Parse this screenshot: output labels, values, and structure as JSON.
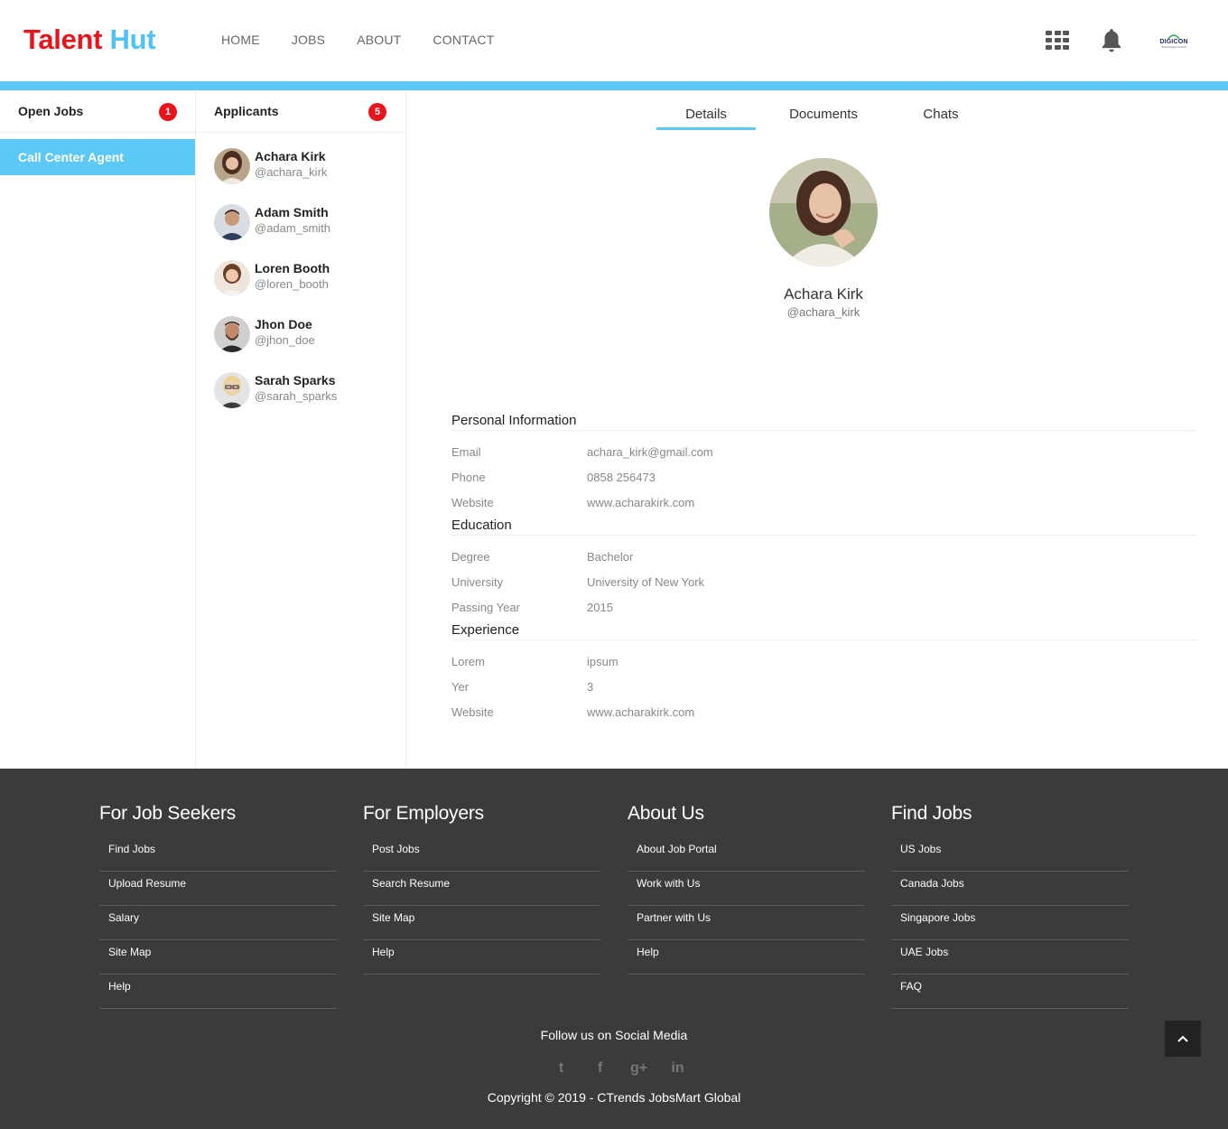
{
  "brand": {
    "part1": "Talent",
    "part2": "Hut"
  },
  "nav": [
    "HOME",
    "JOBS",
    "ABOUT",
    "CONTACT"
  ],
  "header_icons": {
    "apps": "grid-icon",
    "notifications": "bell-icon",
    "company_logo_text": "DIGICON",
    "company_logo_sub": "Technologies Limited"
  },
  "open_jobs": {
    "title": "Open Jobs",
    "count": "1",
    "items": [
      "Call Center Agent"
    ]
  },
  "applicants": {
    "title": "Applicants",
    "count": "5",
    "items": [
      {
        "name": "Achara Kirk",
        "handle": "@achara_kirk"
      },
      {
        "name": "Adam Smith",
        "handle": "@adam_smith"
      },
      {
        "name": "Loren Booth",
        "handle": "@loren_booth"
      },
      {
        "name": "Jhon Doe",
        "handle": "@jhon_doe"
      },
      {
        "name": "Sarah Sparks",
        "handle": "@sarah_sparks"
      }
    ]
  },
  "tabs": [
    "Details",
    "Documents",
    "Chats"
  ],
  "profile": {
    "name": "Achara Kirk",
    "handle": "@achara_kirk"
  },
  "personal": {
    "title": "Personal Information",
    "rows": [
      {
        "label": "Email",
        "value": "achara_kirk@gmail.com"
      },
      {
        "label": "Phone",
        "value": "0858 256473"
      },
      {
        "label": "Website",
        "value": "www.acharakirk.com"
      }
    ]
  },
  "education": {
    "title": "Education",
    "rows": [
      {
        "label": "Degree",
        "value": "Bachelor"
      },
      {
        "label": "University",
        "value": "University of New York"
      },
      {
        "label": "Passing Year",
        "value": "2015"
      }
    ]
  },
  "experience": {
    "title": "Experience",
    "rows": [
      {
        "label": "Lorem",
        "value": "ipsum"
      },
      {
        "label": "Yer",
        "value": "3"
      },
      {
        "label": "Website",
        "value": "www.acharakirk.com"
      }
    ]
  },
  "footer": {
    "columns": [
      {
        "title": "For Job Seekers",
        "links": [
          "Find Jobs",
          "Upload Resume",
          "Salary",
          "Site Map",
          "Help"
        ]
      },
      {
        "title": "For Employers",
        "links": [
          "Post Jobs",
          "Search Resume",
          "Site Map",
          "Help"
        ]
      },
      {
        "title": "About Us",
        "links": [
          "About Job Portal",
          "Work with Us",
          "Partner with Us",
          "Help"
        ]
      },
      {
        "title": "Find Jobs",
        "links": [
          "US Jobs",
          "Canada Jobs",
          "Singapore Jobs",
          "UAE Jobs",
          "FAQ"
        ]
      }
    ],
    "follow": "Follow us on Social Media",
    "social": [
      {
        "icon": "twitter-icon",
        "glyph": "t"
      },
      {
        "icon": "facebook-icon",
        "glyph": "f"
      },
      {
        "icon": "google-plus-icon",
        "glyph": "g+"
      },
      {
        "icon": "linkedin-icon",
        "glyph": "in"
      }
    ],
    "copyright": "Copyright © 2019 - CTrends JobsMart Global"
  }
}
